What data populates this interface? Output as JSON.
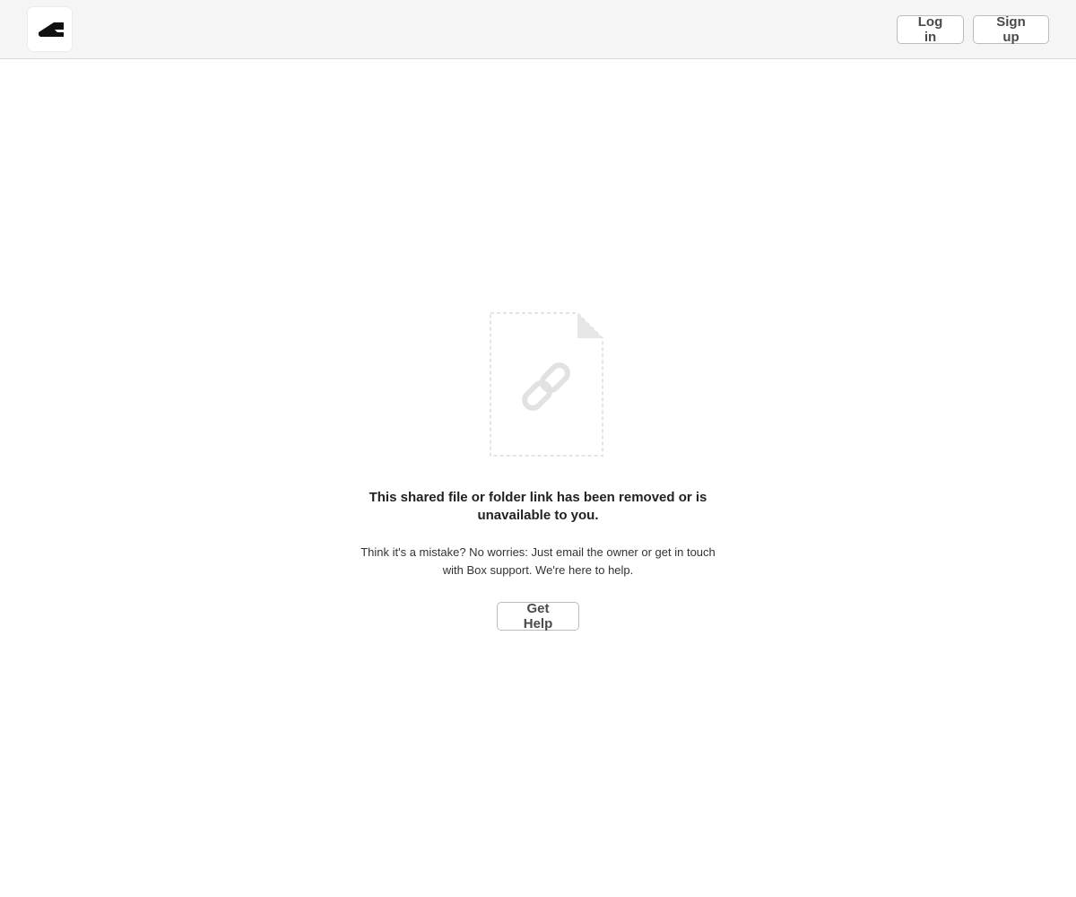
{
  "header": {
    "logo_icon": "box-logo-icon",
    "login_label": "Log in",
    "signup_label": "Sign up"
  },
  "illustration": {
    "icon": "broken-link-icon"
  },
  "message": {
    "title": "This shared file or folder link has been removed or is unavailable to you.",
    "description": "Think it's a mistake? No worries: Just email the owner or get in touch with Box support. We're here to help.",
    "help_label": "Get Help"
  },
  "colors": {
    "header_bg": "#f5f5f5",
    "button_border": "#bcbcbc",
    "button_text": "#4a4a4a",
    "placeholder_gray": "#e2e2e2"
  }
}
